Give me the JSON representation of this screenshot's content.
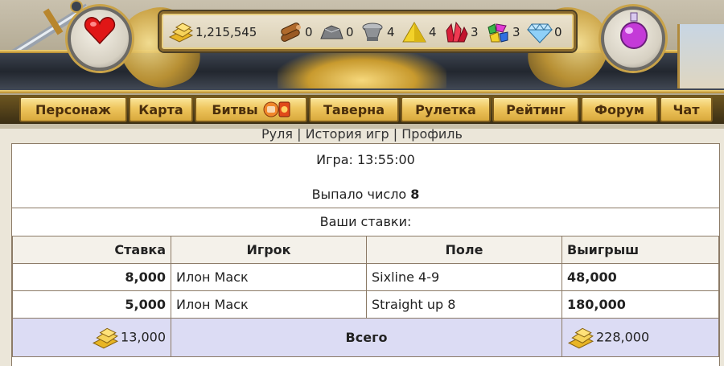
{
  "resources": [
    {
      "name": "gold-icon",
      "value": "1,215,545"
    },
    {
      "name": "wood-icon",
      "value": "0"
    },
    {
      "name": "stone-icon",
      "value": "0"
    },
    {
      "name": "iron-icon",
      "value": "4"
    },
    {
      "name": "sulfur-icon",
      "value": "4"
    },
    {
      "name": "crystal-icon",
      "value": "3"
    },
    {
      "name": "gems-icon",
      "value": "3"
    },
    {
      "name": "diamond-icon",
      "value": "0"
    }
  ],
  "nav": {
    "items": [
      {
        "label": "Персонаж"
      },
      {
        "label": "Карта"
      },
      {
        "label": "Битвы"
      },
      {
        "label": "Таверна"
      },
      {
        "label": "Рулетка"
      },
      {
        "label": "Рейтинг"
      },
      {
        "label": "Форум"
      },
      {
        "label": "Чат"
      }
    ]
  },
  "sublinks": {
    "roulette": "Руля",
    "history": "История игр",
    "profile": "Профиль",
    "sep": "|"
  },
  "game": {
    "time_label": "Игра: 13:55:00",
    "result_label": "Выпало число",
    "result_number": "8",
    "bets_title": "Ваши ставки:"
  },
  "table": {
    "headers": {
      "bet": "Ставка",
      "player": "Игрок",
      "field": "Поле",
      "win": "Выигрыш"
    },
    "rows": [
      {
        "bet": "8,000",
        "player": "Илон Маск",
        "field": "Sixline 4-9",
        "win": "48,000"
      },
      {
        "bet": "5,000",
        "player": "Илон Маск",
        "field": "Straight up 8",
        "win": "180,000"
      }
    ],
    "total": {
      "bet": "13,000",
      "label": "Всего",
      "win": "228,000"
    }
  },
  "colors": {
    "nav_gold": "#eec55d",
    "total_row": "#dcdcf4",
    "border": "#8c7b67"
  }
}
